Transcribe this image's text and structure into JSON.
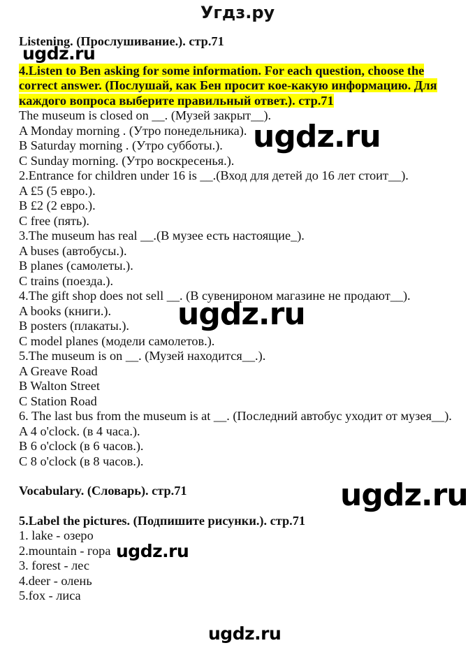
{
  "site_title": "Угдз.ру",
  "watermark_text": "ugdz.ru",
  "colors": {
    "highlight": "#ffff00",
    "text": "#111111"
  },
  "listening": {
    "heading": "Listening. (Прослушивание.). стр.71",
    "task_title": "4.Listen to Ben asking for some information. For each question, choose the correct answer. (Послушай, как Бен просит кое-какую информацию. Для каждого вопроса выберите правильный ответ.). стр.71",
    "questions": [
      {
        "question": "The museum is closed on __. (Музей закрыт__).",
        "options": [
          "A Monday morning . (Утро понедельника).",
          "B Saturday morning . (Утро субботы.).",
          "C Sunday morning. (Утро воскресенья.)."
        ]
      },
      {
        "question": "2.Entrance for children under 16 is __.(Вход для детей до 16 лет стоит__).",
        "options": [
          "A £5 (5 евро.).",
          "B £2 (2 евро.).",
          "C free (пять)."
        ]
      },
      {
        "question": "3.The museum has real __.(В музее есть настоящие_).",
        "options": [
          "A buses (автобусы.).",
          "B planes (самолеты.).",
          "C trains (поезда.)."
        ]
      },
      {
        "question": "4.The gift shop does not sell __. (В сувенироном магазине не продают__).",
        "options": [
          "A books (книги.).",
          "B posters (плакаты.).",
          "C model planes (модели самолетов.)."
        ]
      },
      {
        "question": "5.The museum is on __. (Музей находится__.).",
        "options": [
          "A Greave Road",
          "B Walton Street",
          "C Station Road"
        ]
      },
      {
        "question": "6. The last bus from the museum is at __. (Последний автобус уходит от музея__).",
        "options": [
          "A 4 o'clock. (в 4 часа.).",
          "B 6 o'clock  (в 6 часов.).",
          "C 8 o'clock (в 8 часов.)."
        ]
      }
    ]
  },
  "vocabulary": {
    "heading": "Vocabulary. (Словарь). стр.71",
    "task_title": "5.Label the pictures. (Подпишите рисунки.). стр.71",
    "items": [
      "1. lake  -  озеро",
      "2.mountain - гора",
      "3. forest - лес",
      "4.deer - олень",
      "5.fox - лиса"
    ]
  }
}
